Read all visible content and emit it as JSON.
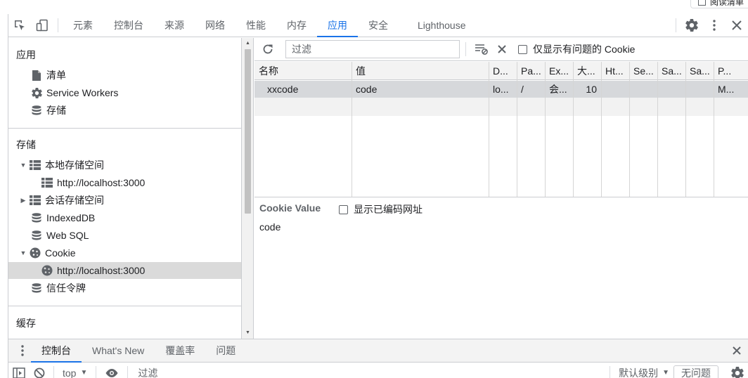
{
  "reading_list": {
    "label": "阅读清单"
  },
  "tabs": [
    "元素",
    "控制台",
    "来源",
    "网络",
    "性能",
    "内存",
    "应用",
    "安全",
    "Lighthouse"
  ],
  "active_tab": "应用",
  "sidebar": {
    "app_section": {
      "title": "应用",
      "items": [
        "清单",
        "Service Workers",
        "存储"
      ]
    },
    "storage_section": {
      "title": "存储",
      "local_storage": "本地存储空间",
      "local_storage_origin": "http://localhost:3000",
      "session_storage": "会话存储空间",
      "indexeddb": "IndexedDB",
      "websql": "Web SQL",
      "cookie": "Cookie",
      "cookie_origin": "http://localhost:3000",
      "trust_tokens": "信任令牌"
    },
    "cache_section": {
      "title": "缓存"
    }
  },
  "toolbar": {
    "filter_placeholder": "过滤",
    "only_issues_label": "仅显示有问题的 Cookie"
  },
  "cookie_table": {
    "columns": [
      "名称",
      "值",
      "D...",
      "Pa...",
      "Ex...",
      "大...",
      "Ht...",
      "Se...",
      "Sa...",
      "Sa...",
      "P..."
    ],
    "rows": [
      [
        "xxcode",
        "code",
        "lo...",
        "/",
        "会...",
        "10",
        "",
        "",
        "",
        "",
        "M..."
      ]
    ]
  },
  "cookie_value": {
    "label": "Cookie Value",
    "show_decoded_label": "显示已编码网址",
    "value": "code"
  },
  "drawer": {
    "tabs": [
      "控制台",
      "What's New",
      "覆盖率",
      "问题"
    ],
    "active_tab": "控制台"
  },
  "console_bar": {
    "context": "top",
    "filter_placeholder": "过滤",
    "level": "默认级别",
    "issues": "无问题"
  }
}
